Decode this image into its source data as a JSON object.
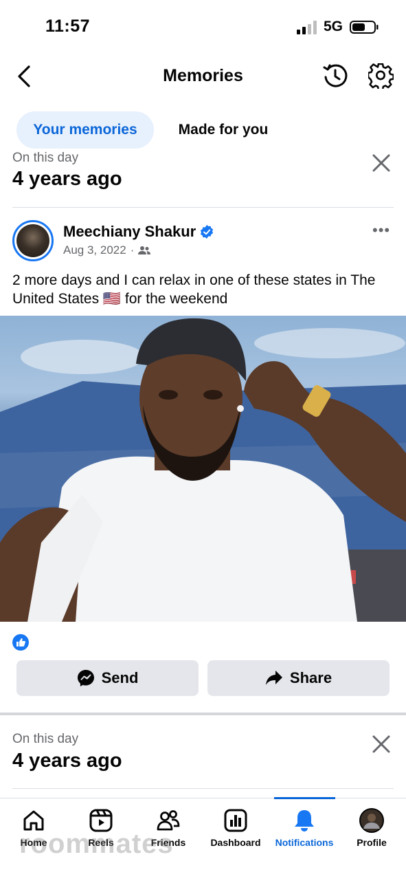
{
  "status_bar": {
    "time": "11:57",
    "network": "5G"
  },
  "header": {
    "title": "Memories"
  },
  "tabs": [
    {
      "label": "Your memories",
      "active": true
    },
    {
      "label": "Made for you",
      "active": false
    }
  ],
  "memories": [
    {
      "on_this_day": "On this day",
      "ago": "4 years ago"
    },
    {
      "on_this_day": "On this day",
      "ago": "4 years ago"
    }
  ],
  "post": {
    "author": "Meechiany Shakur",
    "verified": true,
    "date": "Aug 3, 2022",
    "separator": "·",
    "audience_icon": "friends-icon",
    "text": "2 more days and I can relax in one of these states in The United States 🇺🇸 for the weekend",
    "more": "•••"
  },
  "actions": {
    "send_label": "Send",
    "share_label": "Share"
  },
  "bottom_nav": [
    {
      "label": "Home",
      "icon": "home-icon"
    },
    {
      "label": "Reels",
      "icon": "reels-icon"
    },
    {
      "label": "Friends",
      "icon": "friends-icon"
    },
    {
      "label": "Dashboard",
      "icon": "dashboard-icon"
    },
    {
      "label": "Notifications",
      "icon": "bell-icon",
      "active": true
    },
    {
      "label": "Profile",
      "icon": "profile-avatar"
    }
  ],
  "watermark": "roommates",
  "colors": {
    "accent": "#0a66d8",
    "accent_bg": "#e7f0fd",
    "verified": "#1877f2",
    "button_bg": "#e4e6eb"
  }
}
